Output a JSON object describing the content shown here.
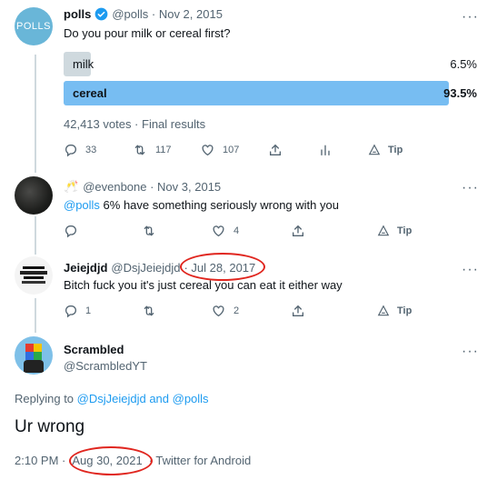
{
  "poll_tweet": {
    "avatar_text": "POLLS",
    "name": "polls",
    "handle_date": "@polls · Nov 2, 2015",
    "text": "Do you pour milk or cereal first?",
    "options": [
      {
        "label": "milk",
        "percent": "6.5%",
        "fraction": 0.065,
        "winner": false
      },
      {
        "label": "cereal",
        "percent": "93.5%",
        "fraction": 0.935,
        "winner": true
      }
    ],
    "summary": "42,413 votes · Final results",
    "actions": {
      "replies": "33",
      "retweets": "117",
      "likes": "107",
      "tip": "Tip"
    }
  },
  "reply1": {
    "emoji": "🥂",
    "handle_date": "@evenbone · Nov 3, 2015",
    "mention": "@polls",
    "text": " 6% have something seriously wrong with you",
    "actions": {
      "replies": "",
      "retweets": "",
      "likes": "4",
      "tip": "Tip"
    }
  },
  "reply2": {
    "name": "Jeiejdjd",
    "handle": "@DsjJeiejdjd",
    "date": "· Jul 28, 2017",
    "text": "Bitch fuck you it's just cereal you can eat it either way",
    "actions": {
      "replies": "1",
      "retweets": "",
      "likes": "2",
      "tip": "Tip"
    }
  },
  "main_tweet": {
    "name": "Scrambled",
    "handle": "@ScrambledYT",
    "replying_prefix": "Replying to ",
    "replying_users": "@DsjJeiejdjd and @polls",
    "text": "Ur wrong",
    "time": "2:10 PM ·",
    "date": "Aug 30, 2021",
    "source": "· Twitter for Android"
  },
  "colors": {
    "accent": "#1d9bf0",
    "poll_winner": "#77bdf2",
    "poll_loser": "#cfd9de",
    "verified": "#1d9bf0",
    "annotation": "#e0261f"
  }
}
